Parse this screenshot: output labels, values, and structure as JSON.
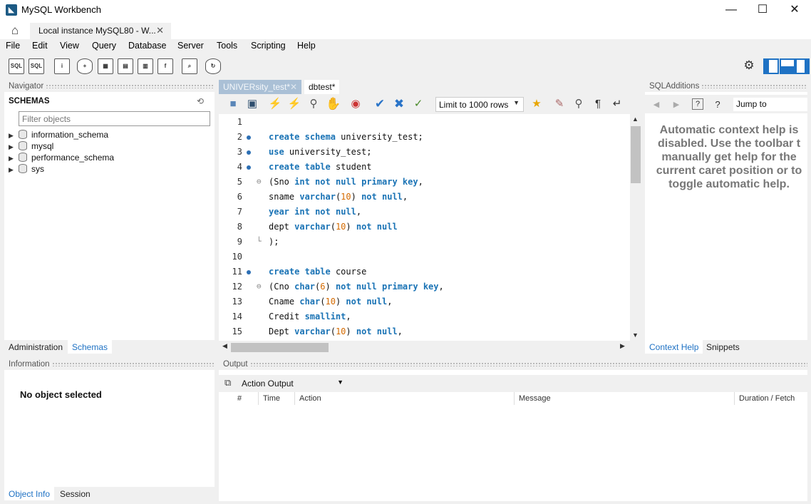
{
  "app": {
    "title": "MySQL Workbench"
  },
  "tabs": {
    "connection_label": "Local instance MySQL80 - W..."
  },
  "menu": [
    "File",
    "Edit",
    "View",
    "Query",
    "Database",
    "Server",
    "Tools",
    "Scripting",
    "Help"
  ],
  "navigator": {
    "title": "Navigator",
    "schemas_label": "SCHEMAS",
    "filter_placeholder": "Filter objects",
    "schemas": [
      "information_schema",
      "mysql",
      "performance_schema",
      "sys"
    ],
    "tabs": [
      "Administration",
      "Schemas"
    ],
    "active_tab": "Schemas"
  },
  "information": {
    "title": "Information",
    "message": "No object selected",
    "tabs": [
      "Object Info",
      "Session"
    ],
    "active_tab": "Object Info"
  },
  "editor": {
    "tabs": [
      {
        "label": "UNIVERsity_test*"
      },
      {
        "label": "dbtest*"
      }
    ],
    "active_tab": "UNIVERsity_test*",
    "limit_label": "Limit to 1000 rows",
    "lines": [
      {
        "n": "1",
        "bp": false,
        "fold": "",
        "tokens": []
      },
      {
        "n": "2",
        "bp": true,
        "fold": "",
        "tokens": [
          [
            "kw",
            "create"
          ],
          [
            "t",
            " "
          ],
          [
            "kw",
            "schema"
          ],
          [
            "t",
            " university_test;"
          ]
        ]
      },
      {
        "n": "3",
        "bp": true,
        "fold": "",
        "tokens": [
          [
            "kw",
            "use"
          ],
          [
            "t",
            " university_test;"
          ]
        ]
      },
      {
        "n": "4",
        "bp": true,
        "fold": "",
        "tokens": [
          [
            "kw",
            "create"
          ],
          [
            "t",
            " "
          ],
          [
            "kw",
            "table"
          ],
          [
            "t",
            " student"
          ]
        ]
      },
      {
        "n": "5",
        "bp": false,
        "fold": "⊖",
        "tokens": [
          [
            "t",
            "(Sno "
          ],
          [
            "kw",
            "int"
          ],
          [
            "t",
            " "
          ],
          [
            "kw",
            "not"
          ],
          [
            "t",
            " "
          ],
          [
            "kw",
            "null"
          ],
          [
            "t",
            " "
          ],
          [
            "kw",
            "primary"
          ],
          [
            "t",
            " "
          ],
          [
            "kw",
            "key"
          ],
          [
            "t",
            ","
          ]
        ]
      },
      {
        "n": "6",
        "bp": false,
        "fold": "",
        "tokens": [
          [
            "t",
            "sname "
          ],
          [
            "kw",
            "varchar"
          ],
          [
            "t",
            "("
          ],
          [
            "num",
            "10"
          ],
          [
            "t",
            ") "
          ],
          [
            "kw",
            "not"
          ],
          [
            "t",
            " "
          ],
          [
            "kw",
            "null"
          ],
          [
            "t",
            ","
          ]
        ]
      },
      {
        "n": "7",
        "bp": false,
        "fold": "",
        "tokens": [
          [
            "kw",
            "year"
          ],
          [
            "t",
            " "
          ],
          [
            "kw",
            "int"
          ],
          [
            "t",
            " "
          ],
          [
            "kw",
            "not"
          ],
          [
            "t",
            " "
          ],
          [
            "kw",
            "null"
          ],
          [
            "t",
            ","
          ]
        ]
      },
      {
        "n": "8",
        "bp": false,
        "fold": "",
        "tokens": [
          [
            "t",
            "dept "
          ],
          [
            "kw",
            "varchar"
          ],
          [
            "t",
            "("
          ],
          [
            "num",
            "10"
          ],
          [
            "t",
            ") "
          ],
          [
            "kw",
            "not"
          ],
          [
            "t",
            " "
          ],
          [
            "kw",
            "null"
          ]
        ]
      },
      {
        "n": "9",
        "bp": false,
        "fold": "└",
        "tokens": [
          [
            "t",
            ");"
          ]
        ]
      },
      {
        "n": "10",
        "bp": false,
        "fold": "",
        "tokens": []
      },
      {
        "n": "11",
        "bp": true,
        "fold": "",
        "tokens": [
          [
            "kw",
            "create"
          ],
          [
            "t",
            " "
          ],
          [
            "kw",
            "table"
          ],
          [
            "t",
            " course"
          ]
        ]
      },
      {
        "n": "12",
        "bp": false,
        "fold": "⊖",
        "tokens": [
          [
            "t",
            "(Cno "
          ],
          [
            "kw",
            "char"
          ],
          [
            "t",
            "("
          ],
          [
            "num",
            "6"
          ],
          [
            "t",
            ") "
          ],
          [
            "kw",
            "not"
          ],
          [
            "t",
            " "
          ],
          [
            "kw",
            "null"
          ],
          [
            "t",
            " "
          ],
          [
            "kw",
            "primary"
          ],
          [
            "t",
            " "
          ],
          [
            "kw",
            "key"
          ],
          [
            "t",
            ","
          ]
        ]
      },
      {
        "n": "13",
        "bp": false,
        "fold": "",
        "tokens": [
          [
            "t",
            "Cname "
          ],
          [
            "kw",
            "char"
          ],
          [
            "t",
            "("
          ],
          [
            "num",
            "10"
          ],
          [
            "t",
            ") "
          ],
          [
            "kw",
            "not"
          ],
          [
            "t",
            " "
          ],
          [
            "kw",
            "null"
          ],
          [
            "t",
            ","
          ]
        ]
      },
      {
        "n": "14",
        "bp": false,
        "fold": "",
        "tokens": [
          [
            "t",
            "Credit "
          ],
          [
            "kw",
            "smallint"
          ],
          [
            "t",
            ","
          ]
        ]
      },
      {
        "n": "15",
        "bp": false,
        "fold": "",
        "tokens": [
          [
            "t",
            "Dept "
          ],
          [
            "kw",
            "varchar"
          ],
          [
            "t",
            "("
          ],
          [
            "num",
            "10"
          ],
          [
            "t",
            ") "
          ],
          [
            "kw",
            "not"
          ],
          [
            "t",
            " "
          ],
          [
            "kw",
            "null"
          ],
          [
            "t",
            ","
          ]
        ]
      }
    ]
  },
  "sql_additions": {
    "title": "SQLAdditions",
    "jump_to": "Jump to",
    "help_lines": [
      "Automatic context help is",
      "disabled. Use the toolbar t",
      "manually get help for the",
      "current caret position or to",
      "toggle automatic help."
    ],
    "tabs": [
      "Context Help",
      "Snippets"
    ],
    "active_tab": "Context Help"
  },
  "output": {
    "title": "Output",
    "selector": "Action Output",
    "columns": [
      "#",
      "Time",
      "Action",
      "Message",
      "Duration / Fetch"
    ]
  },
  "colors": {
    "accent": "#1f72c4",
    "keyword": "#1a73b5",
    "number": "#d46a00",
    "active_tab_bg": "#aac0d6"
  }
}
